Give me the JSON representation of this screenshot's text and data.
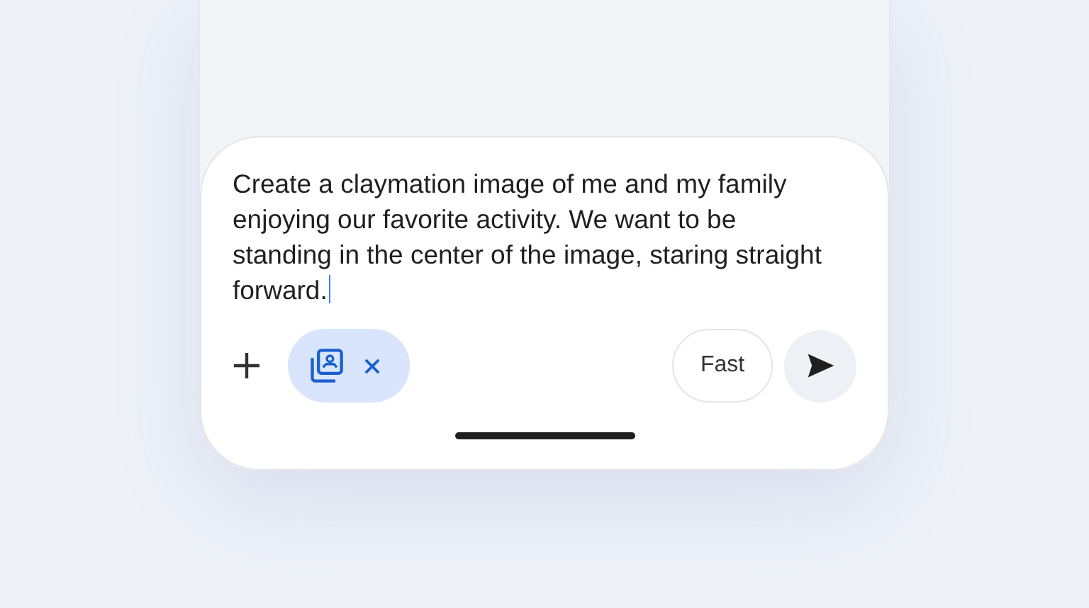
{
  "prompt": {
    "value": "Create a claymation image of me and my family enjoying our favorite activity. We want to be standing in the center of the image, staring straight forward.",
    "focused": true
  },
  "attachment_chip": {
    "kind": "image"
  },
  "mode_button": {
    "label": "Fast"
  },
  "send_button": {
    "disabled": false
  }
}
